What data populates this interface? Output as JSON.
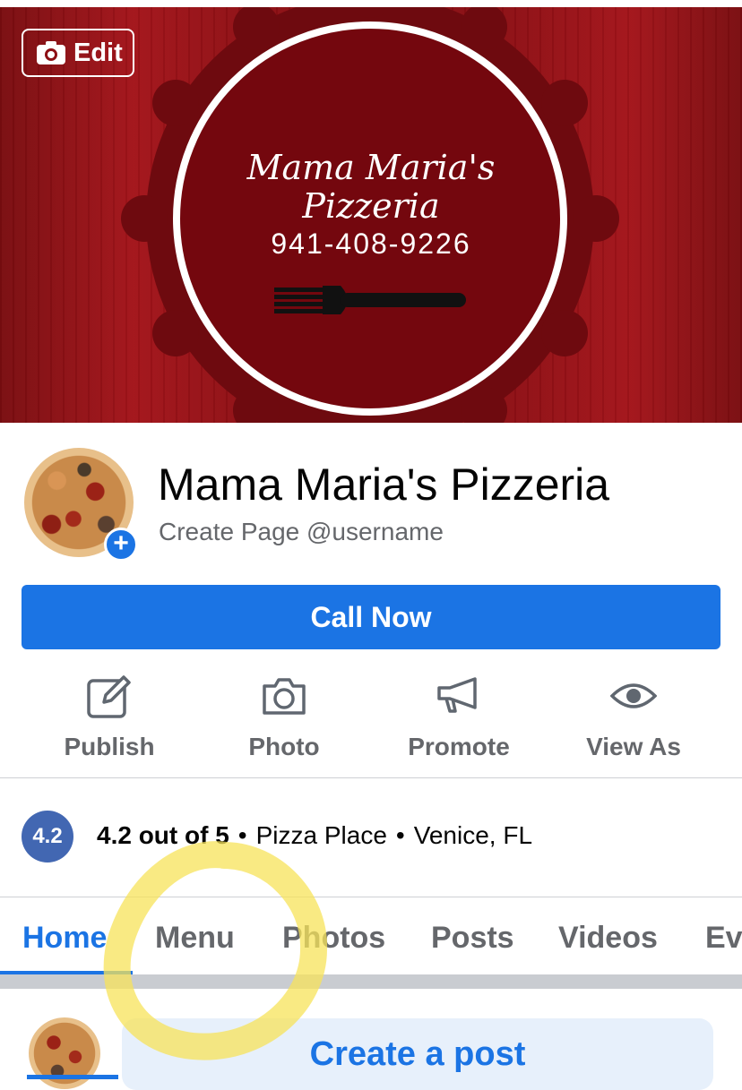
{
  "cover": {
    "edit_label": "Edit",
    "brand_line1": "Mama Maria's",
    "brand_line2": "Pizzeria",
    "phone": "941-408-9226"
  },
  "profile": {
    "name": "Mama Maria's Pizzeria",
    "username_prompt": "Create Page @username",
    "add_photo_symbol": "+"
  },
  "call_button": "Call Now",
  "actions": [
    {
      "label": "Publish",
      "icon": "edit-icon"
    },
    {
      "label": "Photo",
      "icon": "camera-icon"
    },
    {
      "label": "Promote",
      "icon": "megaphone-icon"
    },
    {
      "label": "View As",
      "icon": "eye-icon"
    }
  ],
  "rating": {
    "badge": "4.2",
    "text": "4.2 out of 5",
    "category": "Pizza Place",
    "location": "Venice, FL"
  },
  "tabs": [
    {
      "label": "Home",
      "active": true
    },
    {
      "label": "Menu"
    },
    {
      "label": "Photos"
    },
    {
      "label": "Posts"
    },
    {
      "label": "Videos"
    },
    {
      "label": "Ev"
    }
  ],
  "create_post": "Create a post",
  "colors": {
    "accent": "#1b74e4",
    "cover_red": "#8d0f14",
    "highlight": "#f7e35a"
  }
}
